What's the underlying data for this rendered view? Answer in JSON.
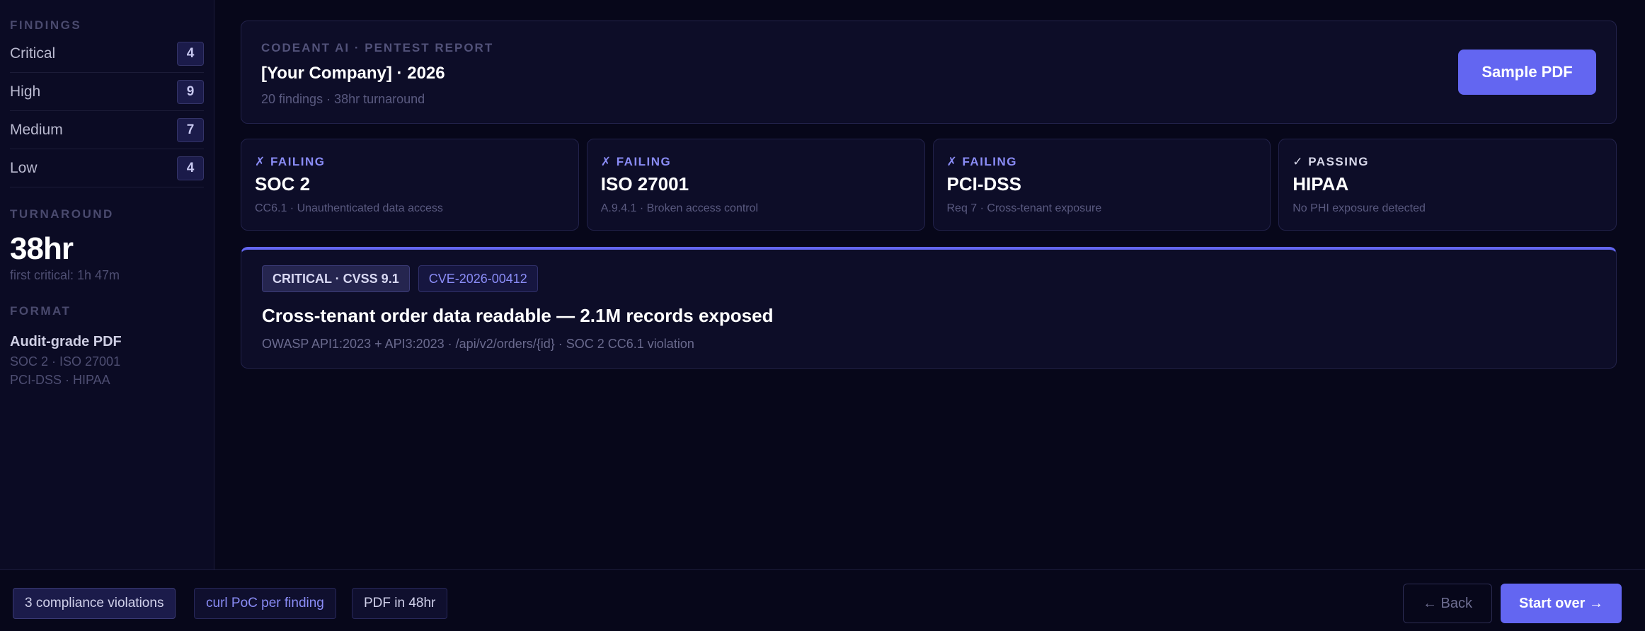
{
  "sidebar": {
    "findings_heading": "FINDINGS",
    "findings": [
      {
        "label": "Critical",
        "count": "4"
      },
      {
        "label": "High",
        "count": "9"
      },
      {
        "label": "Medium",
        "count": "7"
      },
      {
        "label": "Low",
        "count": "4"
      }
    ],
    "turnaround_heading": "TURNAROUND",
    "turnaround_value": "38hr",
    "turnaround_note": "first critical: 1h 47m",
    "format_heading": "FORMAT",
    "format_title": "Audit-grade PDF",
    "format_line1": "SOC 2 · ISO 27001",
    "format_line2": "PCI-DSS · HIPAA"
  },
  "header": {
    "eyebrow": "CODEANT AI · PENTEST REPORT",
    "title": "[Your Company] · 2026",
    "subtitle": "20 findings · 38hr turnaround",
    "sample_button": "Sample PDF"
  },
  "compliance": [
    {
      "status": "✗ FAILING",
      "name": "SOC 2",
      "detail": "CC6.1 · Unauthenticated data access"
    },
    {
      "status": "✗ FAILING",
      "name": "ISO 27001",
      "detail": "A.9.4.1 · Broken access control"
    },
    {
      "status": "✗ FAILING",
      "name": "PCI-DSS",
      "detail": "Req 7 · Cross-tenant exposure"
    },
    {
      "status": "✓ PASSING",
      "name": "HIPAA",
      "detail": "No PHI exposure detected"
    }
  ],
  "finding": {
    "severity_tag": "CRITICAL · CVSS 9.1",
    "cve_tag": "CVE-2026-00412",
    "title": "Cross-tenant order data readable — 2.1M records exposed",
    "meta": "OWASP API1:2023 + API3:2023 · /api/v2/orders/{id} · SOC 2 CC6.1 violation"
  },
  "footer": {
    "pills": [
      "3 compliance violations",
      "curl PoC per finding",
      "PDF in 48hr"
    ],
    "back_button": "← Back",
    "start_button": "Start over →"
  },
  "colors": {
    "accent": "#6366f1",
    "background": "#07071a"
  }
}
